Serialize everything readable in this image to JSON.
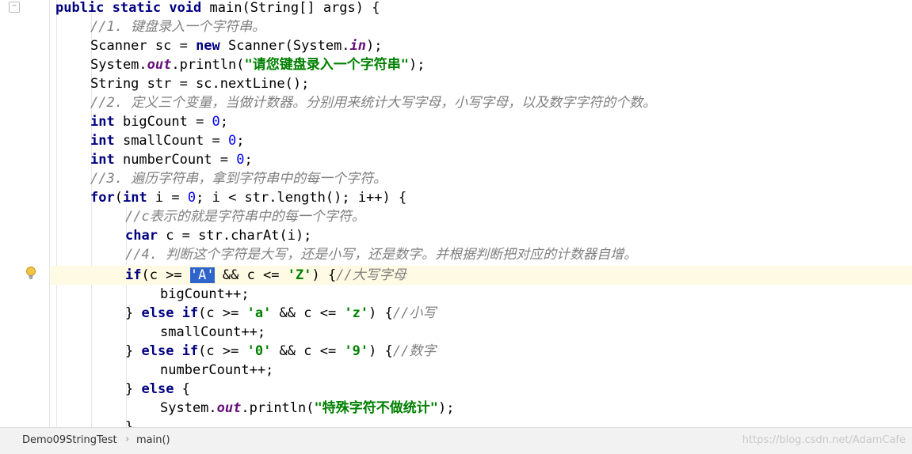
{
  "code": {
    "l1": {
      "kw1": "public",
      "kw2": "static",
      "kw3": "void",
      "rest": " main(String[] args) {"
    },
    "l2": {
      "comment": "//1. 键盘录入一个字符串。"
    },
    "l3": {
      "a": "Scanner sc = ",
      "kw": "new",
      "b": " Scanner(System.",
      "fld": "in",
      "c": ");"
    },
    "l4": {
      "a": "System.",
      "fld": "out",
      "b": ".println(",
      "str": "\"请您键盘录入一个字符串\"",
      "c": ");"
    },
    "l5": {
      "a": "String str = sc.nextLine();"
    },
    "l6": {
      "comment": "//2. 定义三个变量，当做计数器。分别用来统计大写字母，小写字母，以及数字字符的个数。"
    },
    "l7": {
      "kw": "int",
      "a": " bigCount = ",
      "num": "0",
      "b": ";"
    },
    "l8": {
      "kw": "int",
      "a": " smallCount = ",
      "num": "0",
      "b": ";"
    },
    "l9": {
      "kw": "int",
      "a": " numberCount = ",
      "num": "0",
      "b": ";"
    },
    "l10": {
      "comment": "//3. 遍历字符串，拿到字符串中的每一个字符。"
    },
    "l11": {
      "kw1": "for",
      "a": "(",
      "kw2": "int",
      "b": " i = ",
      "num": "0",
      "c": "; i < str.length(); i++) {"
    },
    "l12": {
      "comment": "//c表示的就是字符串中的每一个字符。"
    },
    "l13": {
      "kw": "char",
      "a": " c = str.charAt(i);"
    },
    "l14": {
      "comment": "//4. 判断这个字符是大写，还是小写，还是数字。并根据判断把对应的计数器自增。"
    },
    "l15": {
      "kw": "if",
      "a": "(c >= ",
      "sel": "'A'",
      "b": " && c <= ",
      "str": "'Z'",
      "c": ") {",
      "comment": "//大写字母"
    },
    "l16": {
      "a": "bigCount++;"
    },
    "l17": {
      "a": "} ",
      "kw1": "else",
      "sp": " ",
      "kw2": "if",
      "b": "(c >= ",
      "str1": "'a'",
      "c": " && c <= ",
      "str2": "'z'",
      "d": ") {",
      "comment": "//小写"
    },
    "l18": {
      "a": "smallCount++;"
    },
    "l19": {
      "a": "} ",
      "kw1": "else",
      "sp": " ",
      "kw2": "if",
      "b": "(c >= ",
      "str1": "'0'",
      "c": " && c <= ",
      "str2": "'9'",
      "d": ") {",
      "comment": "//数字"
    },
    "l20": {
      "a": "numberCount++;"
    },
    "l21": {
      "a": "} ",
      "kw": "else",
      "b": " {"
    },
    "l22": {
      "a": "System.",
      "fld": "out",
      "b": ".println(",
      "str": "\"特殊字符不做统计\"",
      "c": ");"
    },
    "l23": {
      "a": "}"
    }
  },
  "breadcrumb": {
    "items": [
      "Demo09StringTest",
      "main()"
    ],
    "separator": "›"
  },
  "watermark": "https://blog.csdn.net/AdamCafe",
  "icons": {
    "fold": "fold-marker-icon",
    "bulb": "lightbulb-icon"
  },
  "colors": {
    "keyword": "#000080",
    "comment": "#808080",
    "string": "#008000",
    "number": "#0000ff",
    "field": "#660e7a",
    "caret_line": "#fffae3",
    "selection": "#2f65ca"
  }
}
